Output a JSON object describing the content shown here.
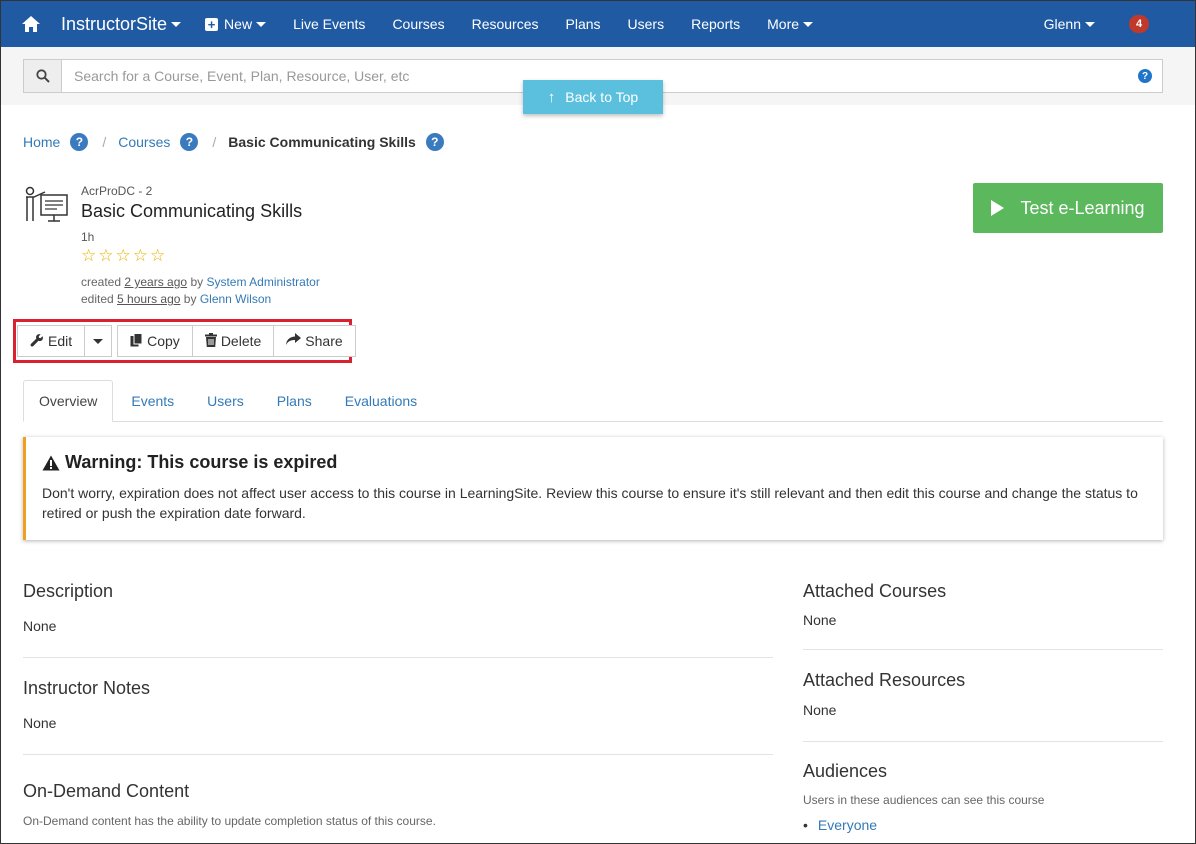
{
  "nav": {
    "brand": "InstructorSite",
    "new_label": "New",
    "items": [
      "Live Events",
      "Courses",
      "Resources",
      "Plans",
      "Users",
      "Reports"
    ],
    "more_label": "More",
    "user": "Glenn",
    "notification_count": "4"
  },
  "search": {
    "placeholder": "Search for a Course, Event, Plan, Resource, User, etc",
    "help": "?"
  },
  "back_to_top": "Back to Top",
  "breadcrumb": {
    "home": "Home",
    "courses": "Courses",
    "current": "Basic Communicating Skills",
    "help": "?"
  },
  "course": {
    "code": "AcrProDC - 2",
    "title": "Basic Communicating Skills",
    "duration": "1h",
    "created_prefix": "created",
    "created_when": "2 years ago",
    "created_by_prefix": "by",
    "created_by": "System Administrator",
    "edited_prefix": "edited",
    "edited_when": "5 hours ago",
    "edited_by_prefix": "by",
    "edited_by": "Glenn Wilson",
    "rating": "0 of 5 stars"
  },
  "test_button": "Test e-Learning",
  "toolbar": {
    "edit": "Edit",
    "copy": "Copy",
    "delete": "Delete",
    "share": "Share"
  },
  "tabs": [
    "Overview",
    "Events",
    "Users",
    "Plans",
    "Evaluations"
  ],
  "warning": {
    "title": "Warning: This course is expired",
    "body": "Don't worry, expiration does not affect user access to this course in LearningSite. Review this course to ensure it's still relevant and then edit this course and change the status to retired or push the expiration date forward."
  },
  "left": {
    "description_title": "Description",
    "description_value": "None",
    "notes_title": "Instructor Notes",
    "notes_value": "None",
    "ondemand_title": "On-Demand Content",
    "ondemand_text": "On-Demand content has the ability to update completion status of this course."
  },
  "right": {
    "attached_courses_title": "Attached Courses",
    "attached_courses_value": "None",
    "attached_resources_title": "Attached Resources",
    "attached_resources_value": "None",
    "audiences_title": "Audiences",
    "audiences_text": "Users in these audiences can see this course",
    "audience_item": "Everyone"
  },
  "colors": {
    "nav": "#1f5aa3",
    "accent_link": "#337ab7",
    "success": "#5cb85c",
    "info": "#5bc0de",
    "warning_border": "#f0a020",
    "highlight": "#d9212f"
  }
}
